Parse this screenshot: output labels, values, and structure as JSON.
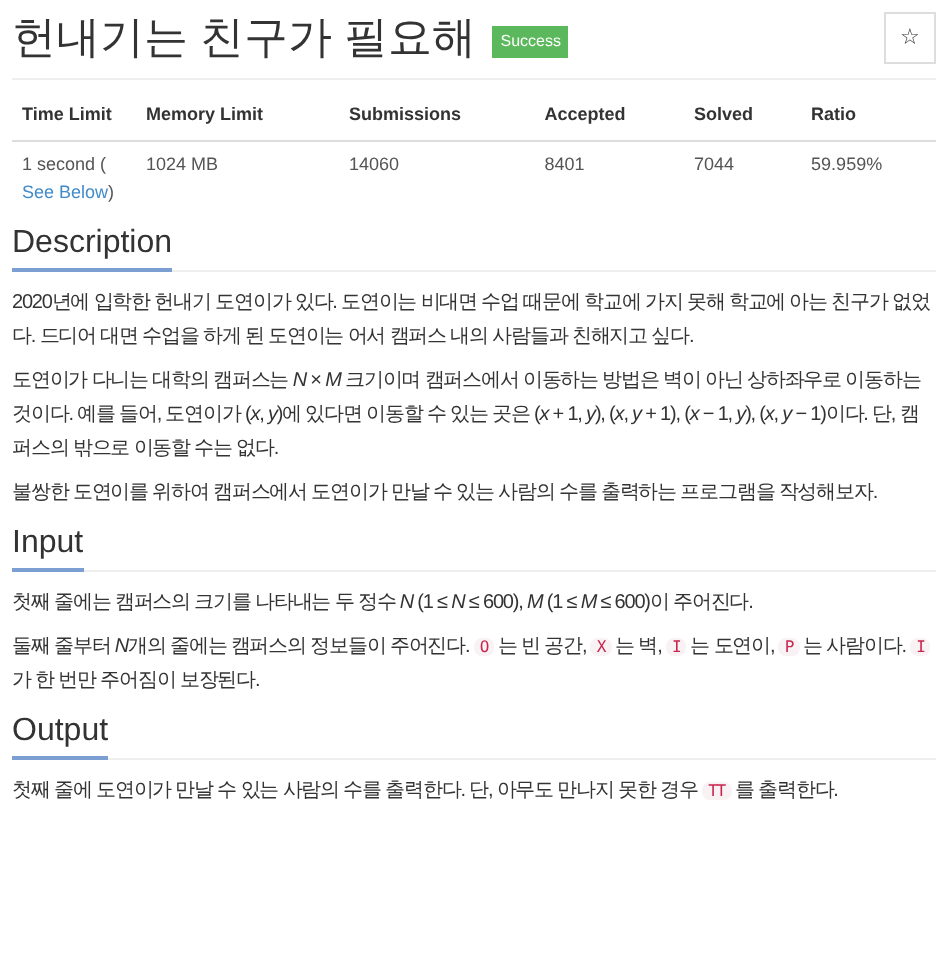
{
  "title": "헌내기는 친구가 필요해",
  "status_badge": "Success",
  "star_button": "☆",
  "table": {
    "columns": [
      "Time Limit",
      "Memory Limit",
      "Submissions",
      "Accepted",
      "Solved",
      "Ratio"
    ],
    "rows": [
      [
        {
          "text": "1 second (",
          "link": "See Below",
          "after": ")"
        },
        {
          "text": "1024 MB"
        },
        {
          "text": "14060"
        },
        {
          "text": "8401"
        },
        {
          "text": "7044"
        },
        {
          "text": "59.959%"
        }
      ]
    ]
  },
  "sections": [
    {
      "heading": "Description",
      "paragraphs": [
        [
          {
            "kind": "text",
            "text": "2020년에 입학한 헌내기 도연이가 있다. 도연이는 비대면 수업 때문에 학교에 가지 못해 학교에 아는 친구가 없었다. 드디어 대면 수업을 하게 된 도연이는 어서 캠퍼스 내의 사람들과 친해지고 싶다."
          }
        ],
        [
          {
            "kind": "text",
            "text": "도연이가 다니는 대학의 캠퍼스는 *N* × *M* 크기이며 캠퍼스에서 이동하는 방법은 벽이 아닌 상하좌우로 이동하는 것이다. 예를 들어, 도연이가 (*x*, *y*)에 있다면 이동할 수 있는 곳은 (*x* + 1, *y*), (*x*, *y* + 1), (*x* − 1, *y*), (*x*, *y* − 1)이다. 단, 캠퍼스의 밖으로 이동할 수는 없다."
          }
        ],
        [
          {
            "kind": "text",
            "text": "불쌍한 도연이를 위하여 캠퍼스에서 도연이가 만날 수 있는 사람의 수를 출력하는 프로그램을 작성해보자."
          }
        ]
      ]
    },
    {
      "heading": "Input",
      "paragraphs": [
        [
          {
            "kind": "text",
            "text": "첫째 줄에는 캠퍼스의 크기를 나타내는 두 정수 *N* (1 ≤ *N* ≤ 600), *M* (1 ≤ *M* ≤ 600)이 주어진다."
          }
        ],
        [
          {
            "kind": "text",
            "text": "둘째 줄부터 "
          },
          {
            "kind": "math",
            "text": "N"
          },
          {
            "kind": "text",
            "text": "개의 줄에는 캠퍼스의 정보들이 주어진다. "
          },
          {
            "kind": "code",
            "text": "O"
          },
          {
            "kind": "text",
            "text": "는 빈 공간, "
          },
          {
            "kind": "code",
            "text": "X"
          },
          {
            "kind": "text",
            "text": "는 벽, "
          },
          {
            "kind": "code",
            "text": "I"
          },
          {
            "kind": "text",
            "text": "는 도연이, "
          },
          {
            "kind": "code",
            "text": "P"
          },
          {
            "kind": "text",
            "text": "는 사람이다. "
          },
          {
            "kind": "code",
            "text": "I"
          },
          {
            "kind": "text",
            "text": "가 한 번만 주어짐이 보장된다."
          }
        ]
      ]
    },
    {
      "heading": "Output",
      "paragraphs": [
        [
          {
            "kind": "text",
            "text": "첫째 줄에 도연이가 만날 수 있는 사람의 수를 출력한다. 단, 아무도 만나지 못한 경우 "
          },
          {
            "kind": "code",
            "text": "TT"
          },
          {
            "kind": "text",
            "text": "를 출력한다."
          }
        ]
      ]
    }
  ]
}
